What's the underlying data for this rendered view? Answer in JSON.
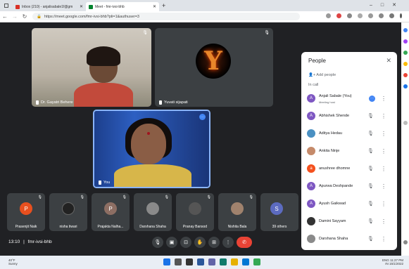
{
  "browser": {
    "tabs": [
      {
        "label": "Inbox (210) - anjalisabale1f@gm"
      },
      {
        "label": "Meet - fmr-ivsi-bhb"
      }
    ],
    "url": "https://meet.google.com/fmr-ivsi-bhb?pli=1&authuser=3"
  },
  "tiles": {
    "t1_name": "Dr. Gayatri Behere",
    "t2_name": "Yuvati sijapati",
    "t2_letter": "Y",
    "t3_name": "You"
  },
  "strip": [
    {
      "name": "Prasenjit Naik",
      "letter": "P",
      "color": "#e8501f"
    },
    {
      "name": "nisha tiwari",
      "letter": "",
      "color": "#222"
    },
    {
      "name": "Prajakta Nalha...",
      "letter": "P",
      "color": "#8d6e63"
    },
    {
      "name": "Darshana Shaha",
      "letter": "",
      "color": "#8a8a8a"
    },
    {
      "name": "Pranay Bansod",
      "letter": "",
      "color": "#555"
    },
    {
      "name": "Nishita Bala",
      "letter": "",
      "color": "#a0826d"
    },
    {
      "name": "39 others",
      "letter": "S",
      "color": "#5c6bc0"
    }
  ],
  "meeting": {
    "time": "13:10",
    "sep": "|",
    "code": "fmr-ivsi-bhb"
  },
  "people": {
    "title": "People",
    "add_label": "Add people",
    "in_call": "In call",
    "host_sub": "Meeting host",
    "list": [
      {
        "name": "Anjali Sabale (You)",
        "letter": "A",
        "color": "#7e57c2"
      },
      {
        "name": "Abhishek Shende",
        "letter": "A",
        "color": "#7e57c2"
      },
      {
        "name": "Aditya Hedau",
        "letter": "",
        "color": "#4a90c2"
      },
      {
        "name": "Ankita Ninje",
        "letter": "",
        "color": "#c58a6a"
      },
      {
        "name": "anushree dhomne",
        "letter": "a",
        "color": "#f4511e"
      },
      {
        "name": "Apurwa Deshpande",
        "letter": "A",
        "color": "#7e57c2"
      },
      {
        "name": "Ayush Gaikwad",
        "letter": "A",
        "color": "#7e57c2"
      },
      {
        "name": "Damini Sayyam",
        "letter": "",
        "color": "#333"
      },
      {
        "name": "Darshana Shaha",
        "letter": "",
        "color": "#8a8a8a"
      }
    ]
  },
  "taskbar": {
    "weather_temp": "40°F",
    "weather_desc": "Sunny",
    "lang": "ENG",
    "region": "IN",
    "time": "11:27 PM",
    "date": "15/1/2022"
  },
  "colors": {
    "meet_bg": "#202124",
    "tile_bg": "#3c4043",
    "end_call": "#ea4335",
    "accent": "#4285f4"
  }
}
